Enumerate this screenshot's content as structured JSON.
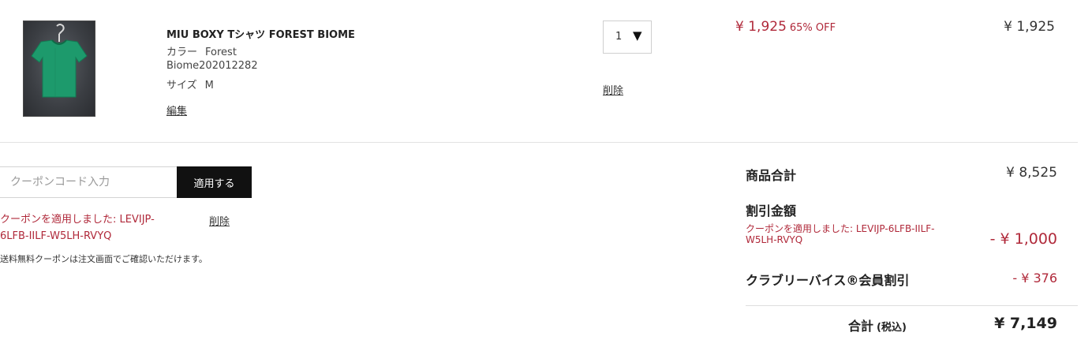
{
  "cart_item": {
    "product_name": "MIU BOXY Tシャツ FOREST BIOME",
    "color_label": "カラー",
    "color_value": "Forest",
    "product_code": "Biome202012282",
    "size_label": "サイズ",
    "size_value": "M",
    "edit_link": "編集",
    "quantity": "1",
    "delete_link": "削除",
    "sale_price": "¥ 1,925",
    "discount_badge": "65% OFF",
    "line_total": "¥ 1,925",
    "image_icon": "tshirt-product-photo"
  },
  "coupon": {
    "input_placeholder": "クーポンコード入力",
    "apply_button": "適用する",
    "applied_message": "クーポンを適用しました: LEVIJP-6LFB-IILF-W5LH-RVYQ",
    "delete_link": "削除",
    "free_shipping_note": "送料無料クーポンは注文画面でご確認いただけます。"
  },
  "summary": {
    "subtotal_label": "商品合計",
    "subtotal_value": "¥ 8,525",
    "discount_label": "割引金額",
    "discount_note": "クーポンを適用しました: LEVIJP-6LFB-IILF-W5LH-RVYQ",
    "discount_value": "- ¥ 1,000",
    "member_discount_label": "クラブリーバイス®会員割引",
    "member_discount_value": "- ¥ 376",
    "total_label": "合計",
    "total_tax_note": "(税込)",
    "total_value": "¥ 7,149"
  },
  "colors": {
    "accent_red": "#b0293a",
    "button_black": "#111111",
    "product_green": "#1d9a6c"
  }
}
